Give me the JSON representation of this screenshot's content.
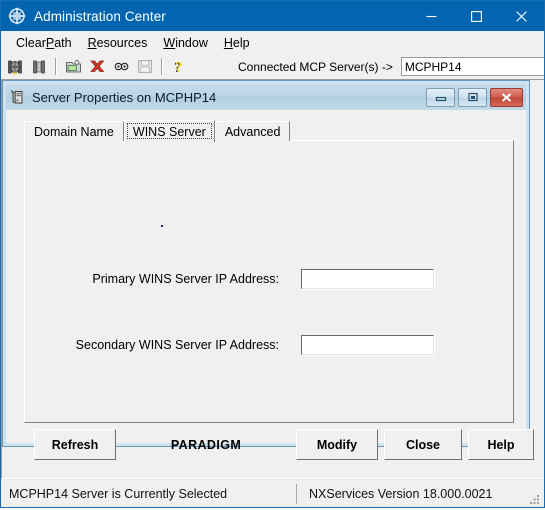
{
  "window": {
    "title": "Administration Center",
    "icon": "compass-icon",
    "controls": {
      "minimize": "minimize-icon",
      "maximize": "maximize-icon",
      "close": "close-icon"
    }
  },
  "menubar": {
    "items": [
      {
        "label": "ClearPath",
        "accel_before": "Clear",
        "accel": "P",
        "accel_after": "ath"
      },
      {
        "label": "Resources",
        "accel_before": "",
        "accel": "R",
        "accel_after": "esources"
      },
      {
        "label": "Window",
        "accel_before": "",
        "accel": "W",
        "accel_after": "indow"
      },
      {
        "label": "Help",
        "accel_before": "",
        "accel": "H",
        "accel_after": "elp"
      }
    ]
  },
  "toolbar": {
    "buttons": [
      {
        "name": "connect-server-icon",
        "title": "Connect"
      },
      {
        "name": "disconnect-server-icon",
        "title": "Disconnect"
      },
      {
        "name": "open-folder-icon",
        "title": "Open"
      },
      {
        "name": "delete-red-x-icon",
        "title": "Delete"
      },
      {
        "name": "link-chain-icon",
        "title": "Link"
      },
      {
        "name": "save-disk-icon",
        "title": "Save"
      },
      {
        "name": "help-question-icon",
        "title": "Help"
      }
    ],
    "connected_label": "Connected MCP Server(s) ->",
    "server_value": "MCPHP14",
    "server_placeholder": ""
  },
  "dialog": {
    "icon": "server-tower-icon",
    "title": "Server Properties on MCPHP14",
    "controls": {
      "minimize": "minimize-icon",
      "restore": "restore-icon",
      "close": "close-icon"
    },
    "tabs": [
      {
        "label": "Domain Name",
        "selected": false
      },
      {
        "label": "WINS Server",
        "selected": true
      },
      {
        "label": "Advanced",
        "selected": false
      }
    ],
    "fields": [
      {
        "label": "Primary WINS Server IP Address:",
        "value": "",
        "placeholder": ""
      },
      {
        "label": "Secondary WINS Server IP Address:",
        "value": "",
        "placeholder": ""
      }
    ],
    "footer": {
      "refresh_label": "Refresh",
      "brand_label": "PARADIGM",
      "modify_label": "Modify",
      "close_label": "Close",
      "help_label": "Help"
    }
  },
  "statusbar": {
    "pane1": "MCPHP14 Server is Currently Selected",
    "pane2": "NXServices Version 18.000.0021",
    "grip": "resize-grip-icon"
  },
  "colors": {
    "title_bar": "#0365b0",
    "window_face": "#f0f0f0",
    "dialog_title": "#bbd4e6",
    "close_red": "#cf5a4c",
    "field_white": "#ffffff"
  }
}
